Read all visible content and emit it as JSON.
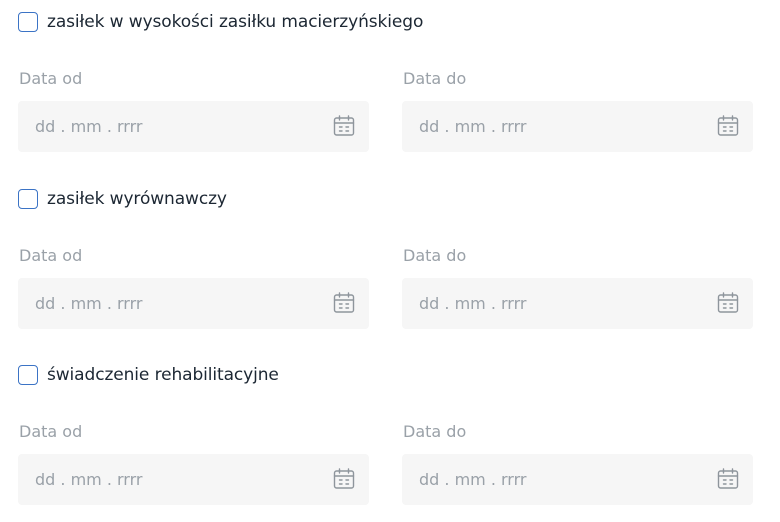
{
  "benefits": [
    {
      "label": "zasiłek w wysokości zasiłku macierzyńskiego",
      "checked": false,
      "date_from": {
        "label": "Data od",
        "placeholder": "dd . mm . rrrr",
        "value": ""
      },
      "date_to": {
        "label": "Data do",
        "placeholder": "dd . mm . rrrr",
        "value": ""
      }
    },
    {
      "label": "zasiłek wyrównawczy",
      "checked": false,
      "date_from": {
        "label": "Data od",
        "placeholder": "dd . mm . rrrr",
        "value": ""
      },
      "date_to": {
        "label": "Data do",
        "placeholder": "dd . mm . rrrr",
        "value": ""
      }
    },
    {
      "label": "świadczenie rehabilitacyjne",
      "checked": false,
      "date_from": {
        "label": "Data od",
        "placeholder": "dd . mm . rrrr",
        "value": ""
      },
      "date_to": {
        "label": "Data do",
        "placeholder": "dd . mm . rrrr",
        "value": ""
      }
    }
  ],
  "icons": {
    "date_picker": "calendar-icon"
  },
  "colors": {
    "checkbox_border": "#3b73c5",
    "label_text": "#1c2733",
    "muted_text": "#9aa1a8",
    "input_background": "#f6f6f6",
    "icon_stroke": "#8e959c"
  }
}
